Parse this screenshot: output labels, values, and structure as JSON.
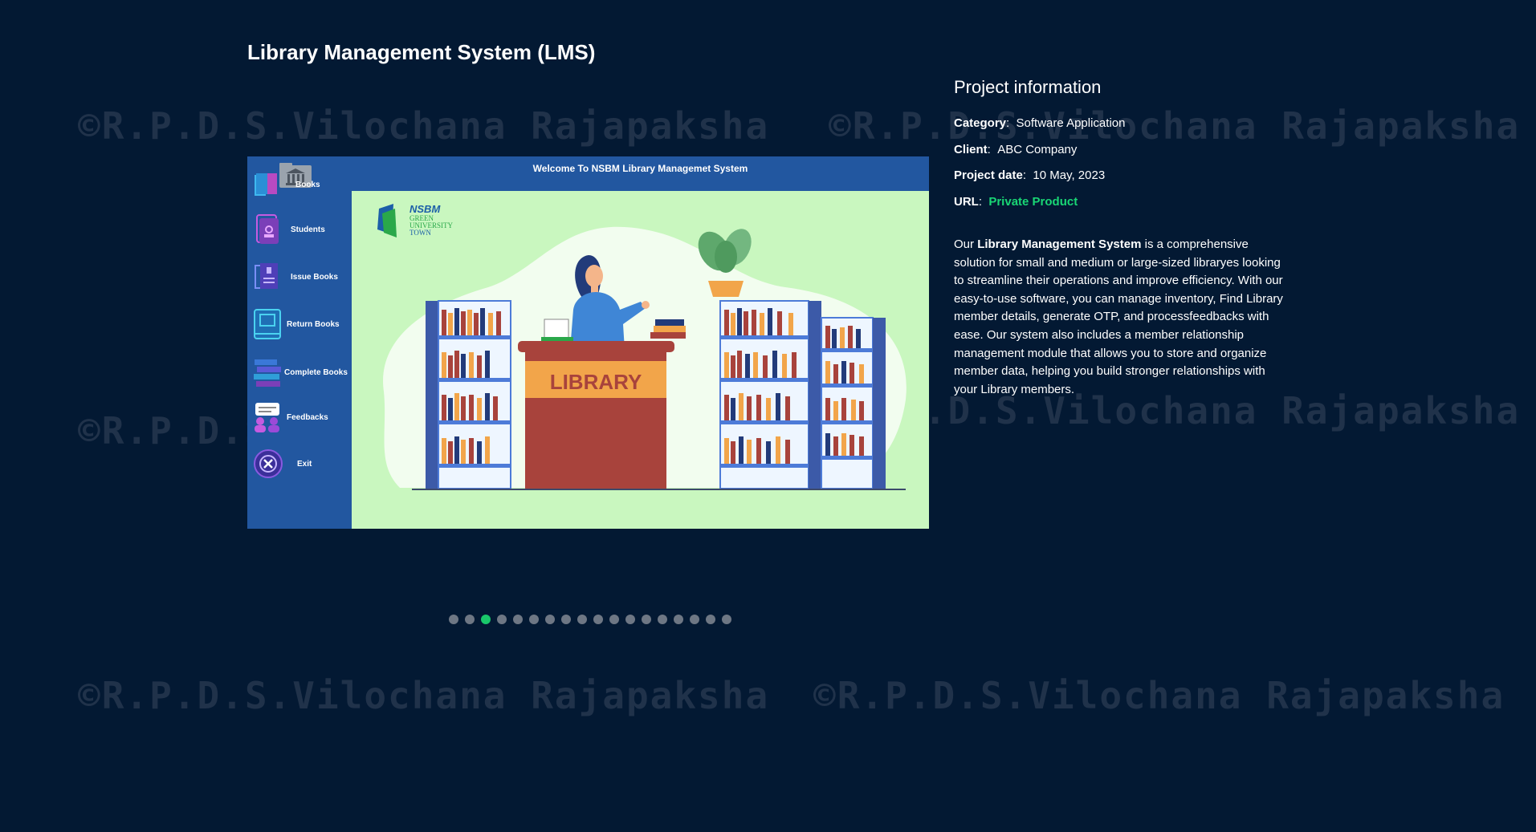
{
  "watermark_text": "©R.P.D.S.Vilochana Rajapaksha",
  "project": {
    "title": "Library Management System (LMS)"
  },
  "app_screenshot": {
    "window_title": "Welcome To NSBM Library Managemet System",
    "menu": [
      {
        "label": "Books",
        "icon": "books-icon"
      },
      {
        "label": "Students",
        "icon": "student-icon"
      },
      {
        "label": "Issue Books",
        "icon": "issue-books-icon"
      },
      {
        "label": "Return Books",
        "icon": "return-books-icon"
      },
      {
        "label": "Complete Books",
        "icon": "complete-books-icon"
      },
      {
        "label": "Feedbacks",
        "icon": "feedbacks-icon"
      },
      {
        "label": "Exit",
        "icon": "exit-icon"
      }
    ],
    "logo_text": "NSBM",
    "logo_sub1": "GREEN",
    "logo_sub2": "UNIVERSITY",
    "logo_sub3": "TOWN",
    "desk_sign": "LIBRARY",
    "colors": {
      "sidebar": "#2257a0",
      "canvas": "#c9f7bf",
      "desk": "#a8433c",
      "desk_sign": "#f2a54a"
    }
  },
  "info": {
    "heading": "Project information",
    "category_label": "Category",
    "category_value": "Software Application",
    "client_label": "Client",
    "client_value": "ABC Company",
    "date_label": "Project date",
    "date_value": "10 May, 2023",
    "url_label": "URL",
    "url_value": "Private Product"
  },
  "description": {
    "prefix": "Our ",
    "highlight": "Library Management System",
    "body": " is a comprehensive solution for small and medium or large-sized libraryes looking to streamline their operations and improve efficiency. With our easy-to-use software, you can manage inventory, Find Library member details, generate OTP, and processfeedbacks with ease. Our system also includes a member relationship management module that allows you to store and organize member data, helping you build stronger relationships with your Library members."
  },
  "carousel": {
    "total": 18,
    "active": 3
  },
  "colors": {
    "background": "#031933",
    "accent": "#19d675",
    "watermark": "#20324a",
    "dot": "#6e7784"
  }
}
